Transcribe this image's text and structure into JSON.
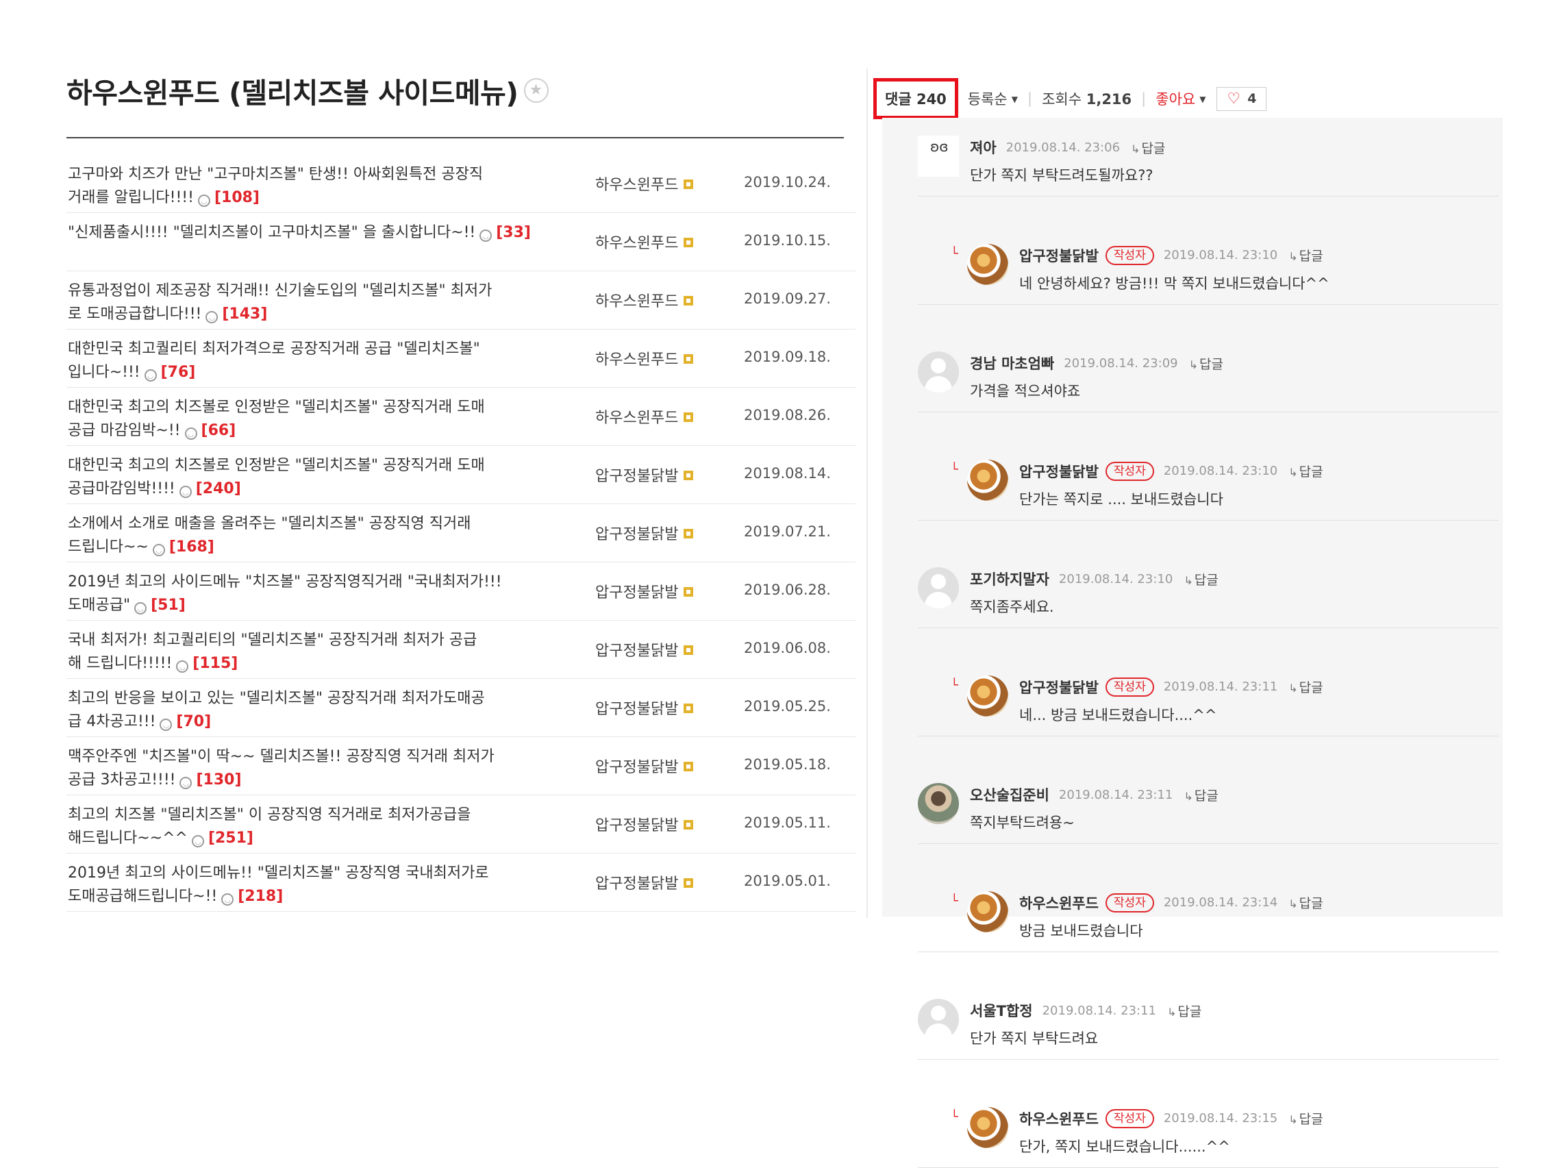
{
  "page_title": "하우스윈푸드 (델리치즈볼 사이드메뉴)",
  "posts": [
    {
      "title_l1": "고구마와 치즈가 만난 \"고구마치즈볼\" 탄생!! 아싸회원특전 공장직",
      "title_l2": "거래를 알립니다!!!!",
      "count": "[108]",
      "author": "하우스윈푸드",
      "date": "2019.10.24."
    },
    {
      "title_l1": "\"신제품출시!!!! \"델리치즈볼이 고구마치즈볼\" 을 출시합니다~!!",
      "title_l2": "",
      "count": "[33]",
      "author": "하우스윈푸드",
      "date": "2019.10.15."
    },
    {
      "title_l1": "유통과정업이 제조공장 직거래!! 신기술도입의 \"델리치즈볼\" 최저가",
      "title_l2": "로 도매공급합니다!!!",
      "count": "[143]",
      "author": "하우스윈푸드",
      "date": "2019.09.27."
    },
    {
      "title_l1": "대한민국 최고퀄리티 최저가격으로 공장직거래 공급 \"델리치즈볼\"",
      "title_l2": "입니다~!!!",
      "count": "[76]",
      "author": "하우스윈푸드",
      "date": "2019.09.18."
    },
    {
      "title_l1": "대한민국 최고의 치즈볼로 인정받은 \"델리치즈볼\" 공장직거래 도매",
      "title_l2": "공급 마감임박~!!",
      "count": "[66]",
      "author": "하우스윈푸드",
      "date": "2019.08.26."
    },
    {
      "title_l1": "대한민국 최고의 치즈볼로 인정받은 \"델리치즈볼\" 공장직거래 도매",
      "title_l2": "공급마감임박!!!!",
      "count": "[240]",
      "author": "압구정불닭발",
      "date": "2019.08.14."
    },
    {
      "title_l1": "소개에서 소개로 매출을 올려주는 \"델리치즈볼\" 공장직영 직거래",
      "title_l2": "드립니다~~",
      "count": "[168]",
      "author": "압구정불닭발",
      "date": "2019.07.21."
    },
    {
      "title_l1": "2019년 최고의 사이드메뉴 \"치즈볼\" 공장직영직거래 \"국내최저가!!!",
      "title_l2": "도매공급\"",
      "count": "[51]",
      "author": "압구정불닭발",
      "date": "2019.06.28."
    },
    {
      "title_l1": "국내 최저가! 최고퀄리티의 \"델리치즈볼\" 공장직거래 최저가 공급",
      "title_l2": "해 드립니다!!!!!",
      "count": "[115]",
      "author": "압구정불닭발",
      "date": "2019.06.08."
    },
    {
      "title_l1": "최고의 반응을 보이고 있는 \"델리치즈볼\" 공장직거래 최저가도매공",
      "title_l2": "급 4차공고!!!",
      "count": "[70]",
      "author": "압구정불닭발",
      "date": "2019.05.25."
    },
    {
      "title_l1": "맥주안주엔 \"치즈볼\"이 딱~~ 델리치즈볼!! 공장직영 직거래 최저가",
      "title_l2": "공급 3차공고!!!!",
      "count": "[130]",
      "author": "압구정불닭발",
      "date": "2019.05.18."
    },
    {
      "title_l1": "최고의 치즈볼 \"델리치즈볼\" 이 공장직영 직거래로 최저가공급을",
      "title_l2": "해드립니다~~^^",
      "count": "[251]",
      "author": "압구정불닭발",
      "date": "2019.05.11."
    },
    {
      "title_l1": "2019년 최고의 사이드메뉴!! \"델리치즈볼\" 공장직영 국내최저가로",
      "title_l2": "도매공급해드립니다~!!",
      "count": "[218]",
      "author": "압구정불닭발",
      "date": "2019.05.01."
    }
  ],
  "header": {
    "comment_label": "댓글",
    "comment_count": "240",
    "sort_label": "등록순",
    "views_label": "조회수",
    "views_count": "1,216",
    "like_sort_label": "좋아요",
    "like_count": "4"
  },
  "reply_label": "답글",
  "writer_badge": "작성자",
  "comments": [
    {
      "author": "져아",
      "time": "2019.08.14. 23:06",
      "text": "단가 쪽지 부탁드려도될까요??",
      "reply": false,
      "writer": false,
      "avatar": "bunny"
    },
    {
      "author": "압구정불닭발",
      "time": "2019.08.14. 23:10",
      "text": "네 안녕하세요? 방금!!! 막 쪽지 보내드렸습니다^^",
      "reply": true,
      "writer": true,
      "avatar": "food"
    },
    {
      "author": "경남 마초엄빠",
      "time": "2019.08.14. 23:09",
      "text": "가격을 적으셔야죠",
      "reply": false,
      "writer": false,
      "avatar": "default"
    },
    {
      "author": "압구정불닭발",
      "time": "2019.08.14. 23:10",
      "text": "단가는 쪽지로 .... 보내드렸습니다",
      "reply": true,
      "writer": true,
      "avatar": "food"
    },
    {
      "author": "포기하지말자",
      "time": "2019.08.14. 23:10",
      "text": "쪽지좀주세요.",
      "reply": false,
      "writer": false,
      "avatar": "default"
    },
    {
      "author": "압구정불닭발",
      "time": "2019.08.14. 23:11",
      "text": "네... 방금 보내드렸습니다....^^",
      "reply": true,
      "writer": true,
      "avatar": "food"
    },
    {
      "author": "오산술집준비",
      "time": "2019.08.14. 23:11",
      "text": "쪽지부탁드려용~",
      "reply": false,
      "writer": false,
      "avatar": "person"
    },
    {
      "author": "하우스윈푸드",
      "time": "2019.08.14. 23:14",
      "text": "방금 보내드렸습니다",
      "reply": true,
      "writer": true,
      "avatar": "food"
    },
    {
      "author": "서울T합정",
      "time": "2019.08.14. 23:11",
      "text": "단가 쪽지 부탁드려요",
      "reply": false,
      "writer": false,
      "avatar": "default"
    },
    {
      "author": "하우스윈푸드",
      "time": "2019.08.14. 23:15",
      "text": "단가, 쪽지 보내드렸습니다......^^",
      "reply": true,
      "writer": true,
      "avatar": "food"
    }
  ]
}
